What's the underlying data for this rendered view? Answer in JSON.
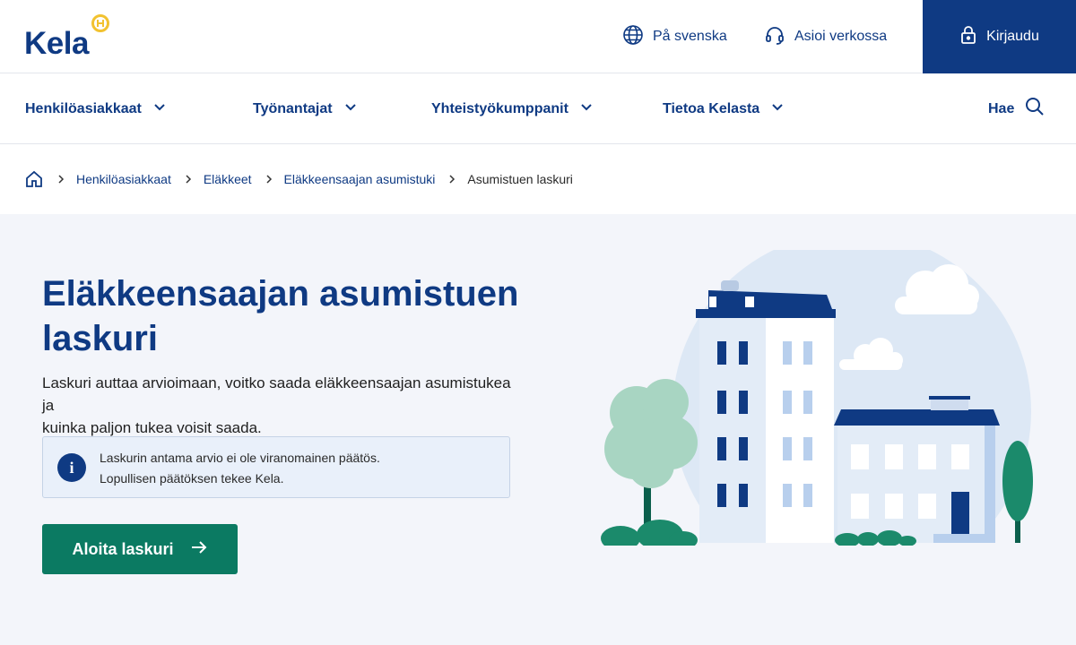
{
  "header": {
    "logo_text": "Kela",
    "swedish_link": "På svenska",
    "online_link": "Asioi verkossa",
    "login_label": "Kirjaudu"
  },
  "nav": {
    "items": [
      {
        "label": "Henkilöasiakkaat"
      },
      {
        "label": "Työnantajat"
      },
      {
        "label": "Yhteistyökumppanit"
      },
      {
        "label": "Tietoa Kelasta"
      }
    ],
    "search_label": "Hae"
  },
  "breadcrumb": {
    "items": [
      "Henkilöasiakkaat",
      "Eläkkeet",
      "Eläkkeensaajan asumistuki"
    ],
    "current": "Asumistuen laskuri"
  },
  "hero": {
    "title_line1": "Eläkkeensaajan asumistuen",
    "title_line2": "laskuri",
    "desc_line1": "Laskuri auttaa arvioimaan, voitko saada eläkkeensaajan asumistukea ja",
    "desc_line2": "kuinka paljon tukea voisit saada.",
    "info_line1": "Laskurin antama arvio ei ole viranomainen päätös.",
    "info_line2": "Lopullisen päätöksen tekee Kela.",
    "info_icon_letter": "i",
    "cta_label": "Aloita laskuri"
  },
  "colors": {
    "brand_blue": "#0f3a83",
    "cta_green": "#0b7a62",
    "logo_yellow": "#f2c230",
    "hero_bg": "#f3f5fa"
  },
  "icons": {
    "globe": "globe-icon",
    "headset": "headset-icon",
    "lock": "lock-icon",
    "chevron": "chevron-down-icon",
    "search": "search-icon",
    "home": "home-icon",
    "info": "info-icon",
    "arrow": "arrow-right-icon"
  }
}
